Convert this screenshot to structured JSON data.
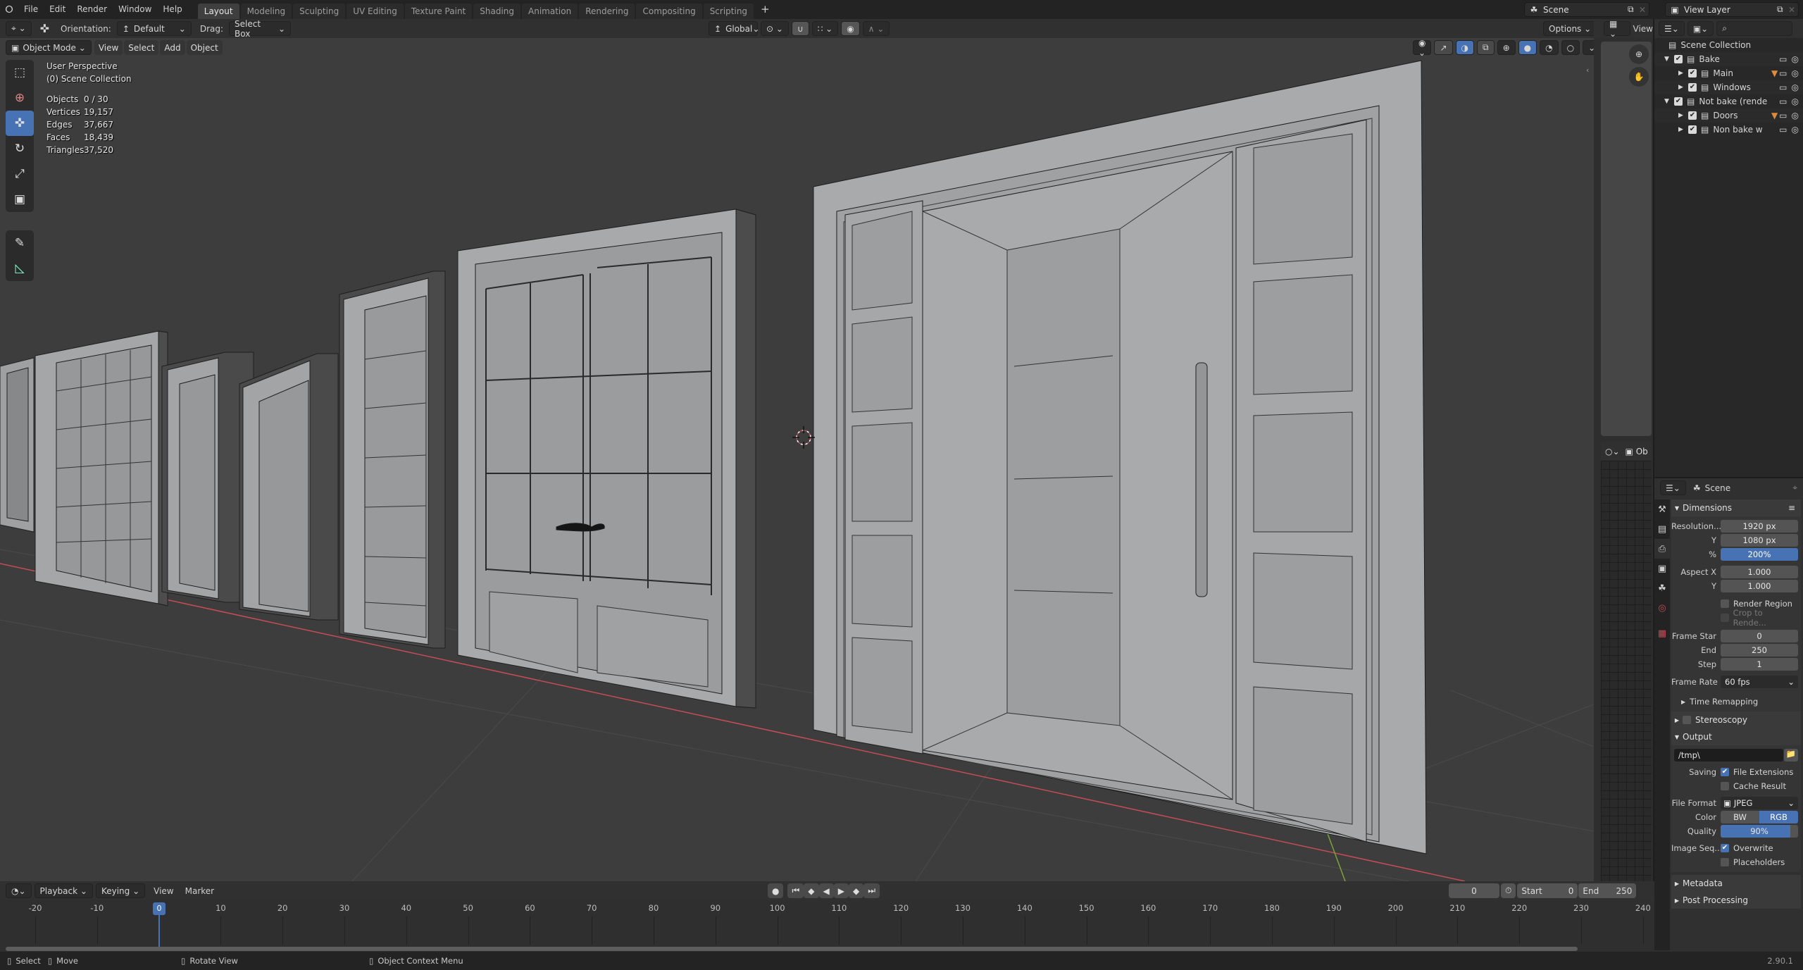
{
  "app": {
    "logo_icon": "blender-logo-icon",
    "version": "2.90.1"
  },
  "menu": [
    "File",
    "Edit",
    "Render",
    "Window",
    "Help"
  ],
  "workspaces": [
    {
      "label": "Layout",
      "active": true
    },
    {
      "label": "Modeling"
    },
    {
      "label": "Sculpting"
    },
    {
      "label": "UV Editing"
    },
    {
      "label": "Texture Paint"
    },
    {
      "label": "Shading"
    },
    {
      "label": "Animation"
    },
    {
      "label": "Rendering"
    },
    {
      "label": "Compositing"
    },
    {
      "label": "Scripting"
    }
  ],
  "add_workspace": "+",
  "scene_selector": {
    "value": "Scene"
  },
  "view_layer_selector": {
    "value": "View Layer"
  },
  "tool_header": {
    "orientation_label": "Orientation:",
    "orientation_value": "Default",
    "drag_label": "Drag:",
    "drag_value": "Select Box",
    "transform_orientation": "Global",
    "options_label": "Options"
  },
  "viewport_header": {
    "mode": "Object Mode",
    "menus": [
      "View",
      "Select",
      "Add",
      "Object"
    ]
  },
  "viewport_overlay": {
    "perspective": "User Perspective",
    "collection": "(0) Scene Collection",
    "stats": [
      {
        "key": "Objects",
        "value": "0 / 30"
      },
      {
        "key": "Vertices",
        "value": "19,157"
      },
      {
        "key": "Edges",
        "value": "37,667"
      },
      {
        "key": "Faces",
        "value": "18,439"
      },
      {
        "key": "Triangles",
        "value": "37,520"
      }
    ]
  },
  "tools": [
    "select-box",
    "cursor",
    "move",
    "rotate",
    "scale",
    "transform",
    "annotate",
    "measure"
  ],
  "image_editor": {
    "view_label": "View",
    "object_label": "Ob"
  },
  "outliner": {
    "root": "Scene Collection",
    "items": [
      {
        "label": "Bake",
        "level": 1,
        "expanded": true
      },
      {
        "label": "Main",
        "level": 2,
        "expanded": false,
        "has_filter": true
      },
      {
        "label": "Windows",
        "level": 2,
        "expanded": false
      },
      {
        "label": "Not bake (rende",
        "level": 1,
        "expanded": true
      },
      {
        "label": "Doors",
        "level": 2,
        "expanded": false,
        "has_filter": true
      },
      {
        "label": "Non bake w",
        "level": 2,
        "expanded": false
      }
    ]
  },
  "properties": {
    "context": "Scene",
    "dimensions": {
      "title": "Dimensions",
      "resolution_x_label": "Resolution...",
      "resolution_x": "1920 px",
      "resolution_y_label": "Y",
      "resolution_y": "1080 px",
      "percent_label": "%",
      "percent": "200%",
      "aspect_x_label": "Aspect X",
      "aspect_x": "1.000",
      "aspect_y_label": "Y",
      "aspect_y": "1.000",
      "render_region": "Render Region",
      "crop": "Crop to Rende...",
      "frame_start_label": "Frame Star",
      "frame_start": "0",
      "end_label": "End",
      "end": "250",
      "step_label": "Step",
      "step": "1",
      "frame_rate_label": "Frame Rate",
      "frame_rate": "60 fps"
    },
    "time_remapping": "Time Remapping",
    "stereoscopy": "Stereoscopy",
    "output": {
      "title": "Output",
      "path": "/tmp\\",
      "saving_label": "Saving",
      "file_extensions": "File Extensions",
      "file_extensions_checked": true,
      "cache_result": "Cache Result",
      "cache_result_checked": false,
      "file_format_label": "File Format",
      "file_format": "JPEG",
      "color_label": "Color",
      "color_options": [
        "BW",
        "RGB"
      ],
      "color_selected": "RGB",
      "quality_label": "Quality",
      "quality": "90%",
      "quality_fraction": 0.9,
      "image_seq_label": "Image Seq...",
      "overwrite": "Overwrite",
      "overwrite_checked": true,
      "placeholders": "Placeholders",
      "placeholders_checked": false
    },
    "metadata": "Metadata",
    "post_processing": "Post Processing"
  },
  "timeline": {
    "editor_menus": [
      "Playback",
      "Keying",
      "View",
      "Marker"
    ],
    "current_frame": "0",
    "start_label": "Start",
    "start": "0",
    "end_label": "End",
    "end": "250",
    "ruler": [
      -20,
      -10,
      0,
      10,
      20,
      30,
      40,
      50,
      60,
      70,
      80,
      90,
      100,
      110,
      120,
      130,
      140,
      150,
      160,
      170,
      180,
      190,
      200,
      210,
      220,
      230,
      240
    ],
    "playhead": "0"
  },
  "statusbar": {
    "hints": [
      {
        "icon": "mouse-left-icon",
        "label": "Select"
      },
      {
        "icon": "mouse-drag-icon",
        "label": "Move"
      },
      {
        "icon": "mouse-middle-icon",
        "label": "Rotate View"
      },
      {
        "icon": "mouse-right-icon",
        "label": "Object Context Menu"
      }
    ]
  },
  "colors": {
    "accent": "#4772b3",
    "x_axis": "#c44c55",
    "y_axis": "#7ba338",
    "mesh": "#a7a9aa",
    "background": "#3d3d3d"
  }
}
